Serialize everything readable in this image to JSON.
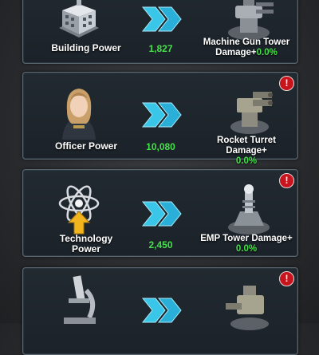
{
  "rows": [
    {
      "left_label": "Building Power",
      "value": "1,827",
      "right_label": "Machine Gun Tower Damage+",
      "right_pct": "0.0%",
      "left_icon": "building-icon",
      "right_icon": "machine-gun-tower-icon",
      "has_alert": false
    },
    {
      "left_label": "Officer Power",
      "value": "10,080",
      "right_label": "Rocket Turret Damage+",
      "right_pct": "0.0%",
      "left_icon": "officer-portrait-icon",
      "right_icon": "rocket-turret-icon",
      "has_alert": true,
      "alert": "!"
    },
    {
      "left_label": "Technology Power",
      "value": "2,450",
      "right_label": "EMP Tower Damage+",
      "right_pct": "0.0%",
      "left_icon": "atom-arrow-icon",
      "right_icon": "emp-tower-icon",
      "has_alert": true,
      "alert": "!"
    },
    {
      "left_icon": "microscope-icon",
      "right_icon": "cannon-tower-icon",
      "has_alert": true,
      "alert": "!"
    }
  ],
  "colors": {
    "value_green": "#45e049",
    "arrow_cyan": "#39c6e8",
    "alert_red": "#c8141c"
  }
}
